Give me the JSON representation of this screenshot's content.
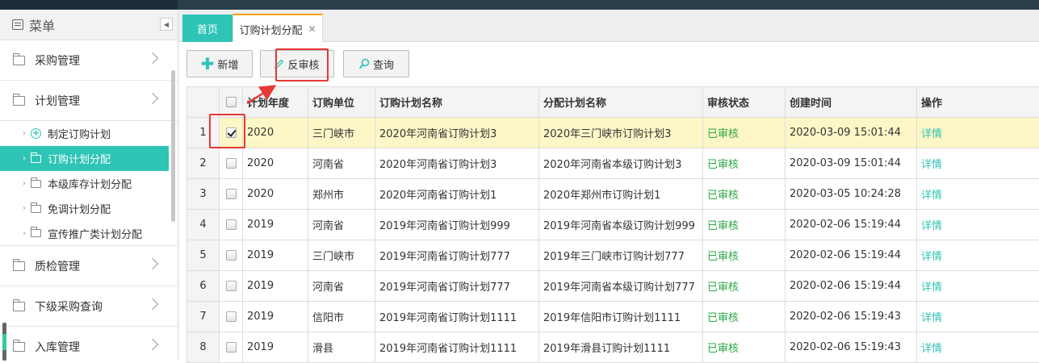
{
  "sidebar": {
    "title": "菜单",
    "groups": [
      {
        "label": "采购管理"
      },
      {
        "label": "计划管理"
      },
      {
        "label": "质检管理"
      },
      {
        "label": "下级采购查询"
      },
      {
        "label": "入库管理"
      }
    ],
    "sub_items": [
      {
        "label": "制定订购计划",
        "icon": "plus-circle-icon"
      },
      {
        "label": "订购计划分配",
        "icon": "folder-open-icon",
        "active": true
      },
      {
        "label": "本级库存计划分配",
        "icon": "folder-icon"
      },
      {
        "label": "免调计划分配",
        "icon": "folder-icon"
      },
      {
        "label": "宣传推广类计划分配",
        "icon": "folder-icon"
      }
    ]
  },
  "tabs": {
    "home": "首页",
    "active": "订购计划分配"
  },
  "toolbar": {
    "add_label": "新增",
    "unaudit_label": "反审核",
    "query_label": "查询"
  },
  "table": {
    "headers": [
      "计划年度",
      "订购单位",
      "订购计划名称",
      "分配计划名称",
      "审核状态",
      "创建时间",
      "操作"
    ],
    "rows": [
      {
        "no": "1",
        "checked": true,
        "year": "2020",
        "unit": "三门峡市",
        "plan": "2020年河南省订购计划3",
        "alloc": "2020年三门峡市订购计划3",
        "status": "已审核",
        "time": "2020-03-09 15:01:44",
        "action": "详情"
      },
      {
        "no": "2",
        "checked": false,
        "year": "2020",
        "unit": "河南省",
        "plan": "2020年河南省订购计划3",
        "alloc": "2020年河南省本级订购计划3",
        "status": "已审核",
        "time": "2020-03-09 15:01:44",
        "action": "详情"
      },
      {
        "no": "3",
        "checked": false,
        "year": "2020",
        "unit": "郑州市",
        "plan": "2020年河南省订购计划1",
        "alloc": "2020年郑州市订购计划1",
        "status": "已审核",
        "time": "2020-03-05 10:24:28",
        "action": "详情"
      },
      {
        "no": "4",
        "checked": false,
        "year": "2019",
        "unit": "河南省",
        "plan": "2019年河南省订购计划999",
        "alloc": "2019年河南省本级订购计划999",
        "status": "已审核",
        "time": "2020-02-06 15:19:44",
        "action": "详情"
      },
      {
        "no": "5",
        "checked": false,
        "year": "2019",
        "unit": "三门峡市",
        "plan": "2019年河南省订购计划777",
        "alloc": "2019年三门峡市订购计划777",
        "status": "已审核",
        "time": "2020-02-06 15:19:44",
        "action": "详情"
      },
      {
        "no": "6",
        "checked": false,
        "year": "2019",
        "unit": "河南省",
        "plan": "2019年河南省订购计划777",
        "alloc": "2019年河南省本级订购计划777",
        "status": "已审核",
        "time": "2020-02-06 15:19:44",
        "action": "详情"
      },
      {
        "no": "7",
        "checked": false,
        "year": "2019",
        "unit": "信阳市",
        "plan": "2019年河南省订购计划1111",
        "alloc": "2019年信阳市订购计划1111",
        "status": "已审核",
        "time": "2020-02-06 15:19:43",
        "action": "详情"
      },
      {
        "no": "8",
        "checked": false,
        "year": "2019",
        "unit": "滑县",
        "plan": "2019年河南省订购计划1111",
        "alloc": "2019年滑县订购计划1111",
        "status": "已审核",
        "time": "2020-02-06 15:19:43",
        "action": "详情"
      }
    ]
  },
  "colors": {
    "accent": "#2ec4b6",
    "selected_row": "#fdf6c6",
    "status_green": "#2aa843",
    "annotation_red": "#e53935"
  }
}
